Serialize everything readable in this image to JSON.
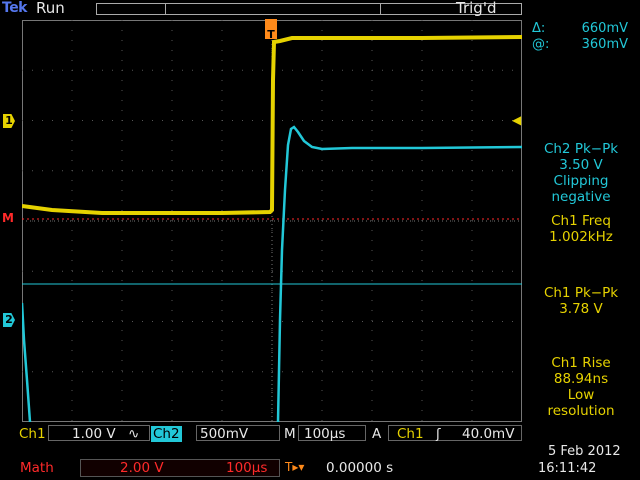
{
  "header": {
    "brand": "Tek",
    "run_state": "Run",
    "trigger_state": "Trig'd"
  },
  "markers": {
    "ch1": "1",
    "ch2": "2",
    "math": "M",
    "trigger_pos": "T",
    "trigger_level": "◀"
  },
  "cursor_readout": {
    "delta_label": "Δ:",
    "delta_value": "660mV",
    "at_label": "@:",
    "at_value": "360mV"
  },
  "measurements": [
    {
      "lines": [
        "Ch2 Pk−Pk",
        "3.50 V",
        "Clipping",
        "negative"
      ],
      "color": "#22c8d8"
    },
    {
      "lines": [
        "Ch1 Freq",
        "1.002kHz"
      ],
      "color": "#e6d200"
    },
    {
      "lines": [
        "Ch1 Pk−Pk",
        "3.78 V"
      ],
      "color": "#e6d200"
    },
    {
      "lines": [
        "Ch1 Rise",
        "88.94ns",
        "Low",
        "resolution"
      ],
      "color": "#e6d200"
    }
  ],
  "bottom": {
    "ch1_label": "Ch1",
    "ch1_scale": "1.00 V",
    "ch1_coupling": "∿",
    "ch2_label": "Ch2",
    "ch2_scale": "500mV",
    "timebase_label": "M",
    "timebase_value": "100µs",
    "trigger_label": "A",
    "trigger_source": "Ch1",
    "trigger_slope": "ʃ",
    "trigger_level": "40.0mV",
    "math_label": "Math",
    "math_scale": "2.00 V",
    "math_time": "100µs",
    "trig_offset_icon": "T▸▾",
    "trig_offset": "0.00000 s",
    "date": "5 Feb  2012",
    "time": "16:11:42"
  },
  "colors": {
    "ch1": "#e6d200",
    "ch2": "#22c8d8",
    "math": "#ff2a2a",
    "trigger": "#ff8a1a",
    "graticule": "#777777"
  }
}
